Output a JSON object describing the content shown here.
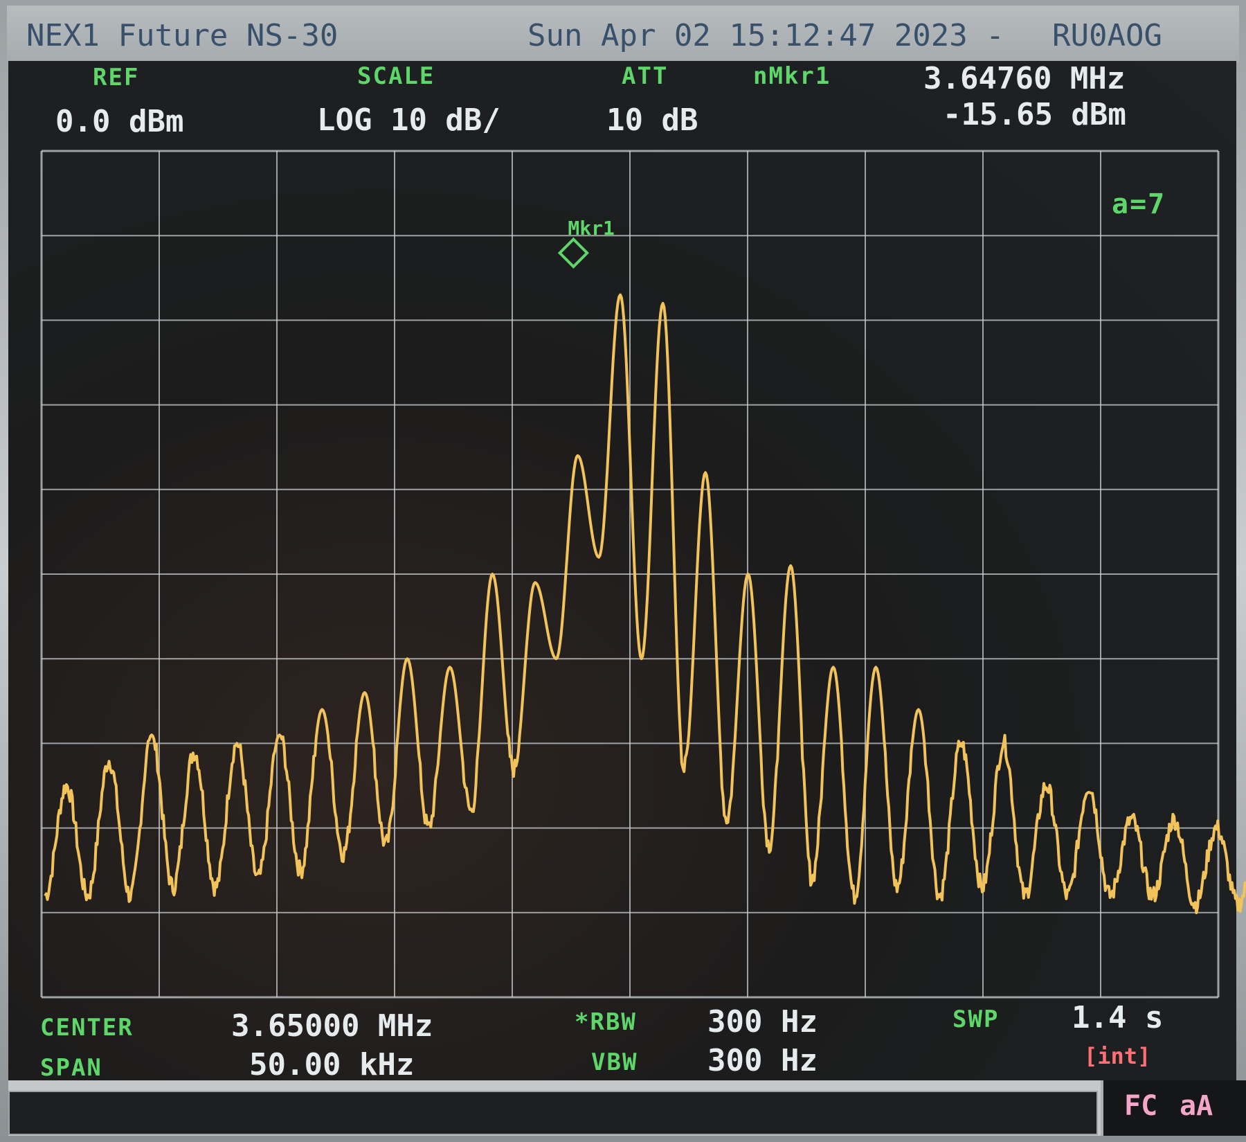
{
  "header": {
    "instrument": "NEX1 Future NS-30",
    "datetime": "Sun Apr 02 15:12:47 2023 -",
    "callsign": "RU0AOG"
  },
  "top_labels": {
    "ref_label": "REF",
    "ref_value": "0.0 dBm",
    "scale_label": "SCALE",
    "scale_value": "LOG 10 dB/",
    "att_label": "ATT",
    "att_value": "10 dB",
    "marker_label": "nMkr1",
    "marker_freq": "3.64760 MHz",
    "marker_level": "-15.65 dBm"
  },
  "averaging": "a=7",
  "marker_tag": "Mkr1",
  "bottom_labels": {
    "center_label": "CENTER",
    "center_value": "3.65000 MHz",
    "span_label": "SPAN",
    "span_value": "50.00 kHz",
    "rbw_label": "*RBW",
    "rbw_value": "300 Hz",
    "vbw_label": "VBW",
    "vbw_value": "300 Hz",
    "swp_label": "SWP",
    "swp_value": "1.4 s",
    "int_label": "[int]"
  },
  "status": {
    "fc": "FC",
    "aa": "aA"
  },
  "colors": {
    "trace": "#f2c35a",
    "grid": "#c9ced1",
    "marker": "#5ed66a"
  },
  "chart_data": {
    "type": "line",
    "xlim": [
      3.625,
      3.675
    ],
    "ylim": [
      -100,
      0
    ],
    "grid": true,
    "marker": {
      "x": 3.6476,
      "y": -15.65
    },
    "peaks": {
      "x": [
        3.62606,
        3.62787,
        3.62968,
        3.63149,
        3.6333,
        3.63511,
        3.63692,
        3.63873,
        3.64054,
        3.64235,
        3.64416,
        3.64597,
        3.64778,
        3.64959,
        3.6514,
        3.65321,
        3.65502,
        3.65683,
        3.65864,
        3.66045,
        3.66226,
        3.66407,
        3.66588,
        3.66769,
        3.6695,
        3.67131,
        3.67312,
        3.67493,
        3.67674
      ],
      "y": [
        -75,
        -72,
        -69,
        -71,
        -70,
        -69,
        -66,
        -64,
        -60,
        -61,
        -50,
        -51,
        -36,
        -17,
        -18,
        -38,
        -50,
        -49,
        -61,
        -61,
        -66,
        -70,
        -70,
        -75,
        -75,
        -79,
        -79,
        -80,
        -82
      ]
    },
    "valleys": {
      "x": [
        3.62515,
        3.62696,
        3.62877,
        3.63058,
        3.63239,
        3.6342,
        3.63601,
        3.63782,
        3.63963,
        3.64144,
        3.64325,
        3.64506,
        3.64687,
        3.64868,
        3.65049,
        3.6523,
        3.65411,
        3.65592,
        3.65773,
        3.65954,
        3.66135,
        3.66316,
        3.66497,
        3.66678,
        3.66859,
        3.6704,
        3.67221,
        3.67402,
        3.67583
      ],
      "y": [
        -88,
        -88,
        -88,
        -87,
        -87,
        -86,
        -85,
        -83,
        -82,
        -80,
        -78,
        -73,
        -60,
        -48,
        -60,
        -73,
        -79,
        -82,
        -86,
        -88,
        -87,
        -88,
        -87,
        -88,
        -88,
        -88,
        -88,
        -89,
        -89
      ]
    }
  }
}
